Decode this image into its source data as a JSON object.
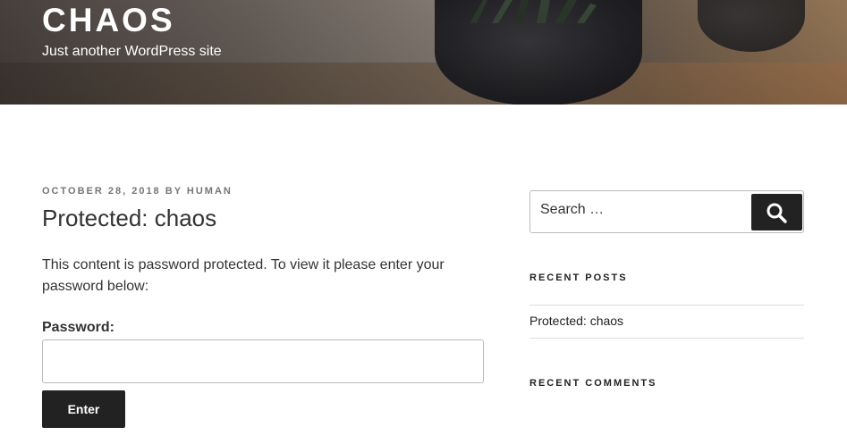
{
  "site": {
    "title": "CHAOS",
    "description": "Just another WordPress site"
  },
  "post": {
    "date": "OCTOBER 28, 2018",
    "by_label": "BY",
    "author": "HUMAN",
    "title": "Protected: chaos",
    "body": "This content is password protected. To view it please enter your password below:",
    "password_label": "Password:",
    "password_value": "",
    "submit_label": "Enter"
  },
  "sidebar": {
    "search": {
      "placeholder": "Search …",
      "button_icon": "search-icon"
    },
    "recent_posts": {
      "title": "RECENT POSTS",
      "items": [
        "Protected: chaos"
      ]
    },
    "recent_comments": {
      "title": "RECENT COMMENTS"
    }
  },
  "colors": {
    "button_bg": "#222222",
    "text": "#333333",
    "meta": "#767676"
  }
}
